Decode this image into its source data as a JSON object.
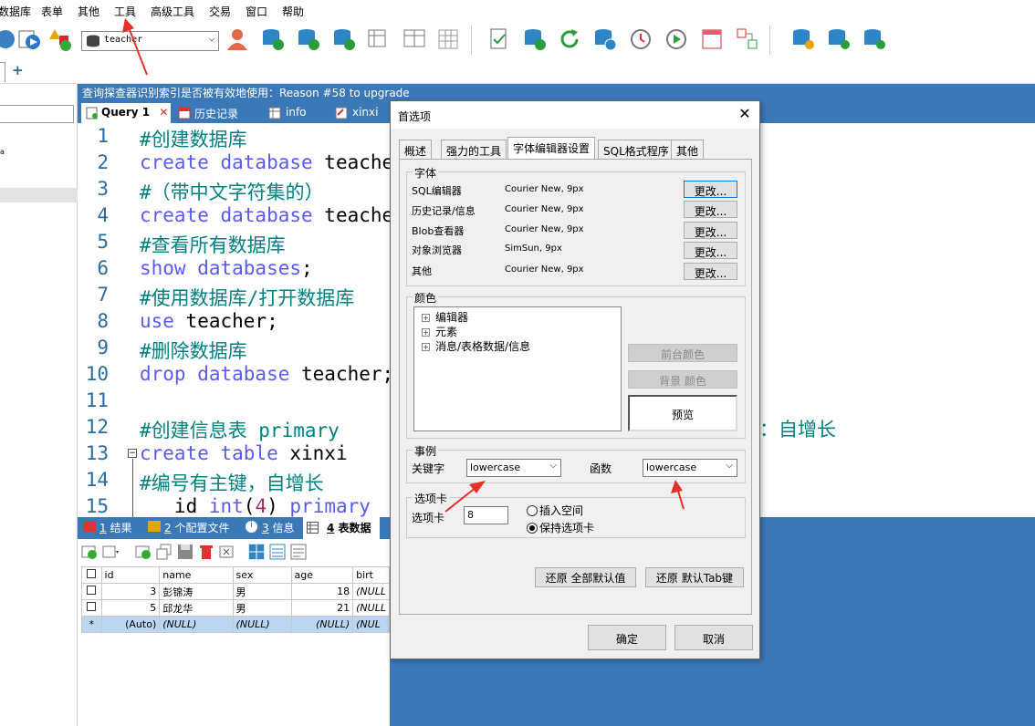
{
  "menu": [
    "数据库",
    "表单",
    "其他",
    "工具",
    "高级工具",
    "交易",
    "窗口",
    "帮助"
  ],
  "toolbar": {
    "db_selected": "teacher"
  },
  "tabstrip": {
    "add_label": "+"
  },
  "infobar": {
    "text": "查询探查器识别索引是否被有效地使用：Reason #58 to upgrade"
  },
  "query_tabs": [
    {
      "label": "Query 1",
      "close": "✕"
    },
    {
      "label": "历史记录"
    },
    {
      "label": "info"
    },
    {
      "label": "xinxi"
    }
  ],
  "editor": {
    "line_numbers": [
      "1",
      "2",
      "3",
      "4",
      "5",
      "6",
      "7",
      "8",
      "9",
      "10",
      "11",
      "12",
      "13",
      "14",
      "15"
    ],
    "lines": [
      [
        {
          "c": "cm",
          "t": "#创建数据库"
        }
      ],
      [
        {
          "c": "kw",
          "t": "create database "
        },
        {
          "c": "tx",
          "t": "teacher;"
        }
      ],
      [
        {
          "c": "cm",
          "t": "#（带中文字符集的）"
        }
      ],
      [
        {
          "c": "kw",
          "t": "create database "
        },
        {
          "c": "tx",
          "t": "teacher"
        }
      ],
      [
        {
          "c": "cm",
          "t": "#查看所有数据库"
        }
      ],
      [
        {
          "c": "kw",
          "t": "show databases"
        },
        {
          "c": "tx",
          "t": ";"
        }
      ],
      [
        {
          "c": "cm",
          "t": "#使用数据库/打开数据库"
        }
      ],
      [
        {
          "c": "kw",
          "t": "use "
        },
        {
          "c": "tx",
          "t": "teacher;"
        }
      ],
      [
        {
          "c": "cm",
          "t": "#删除数据库"
        }
      ],
      [
        {
          "c": "kw",
          "t": "drop database "
        },
        {
          "c": "tx",
          "t": "teacher;"
        }
      ],
      [],
      [
        {
          "c": "cm",
          "t": "#创建信息表 primary"
        }
      ],
      [
        {
          "c": "kw",
          "t": "create table "
        },
        {
          "c": "tx",
          "t": "xinxi"
        }
      ],
      [
        {
          "c": "cm",
          "t": "#编号有主键，自增长"
        }
      ],
      [
        {
          "c": "tx",
          "t": "   id "
        },
        {
          "c": "kw",
          "t": "int"
        },
        {
          "c": "tx",
          "t": "("
        },
        {
          "c": "num",
          "t": "4"
        },
        {
          "c": "tx",
          "t": ") "
        },
        {
          "c": "kw",
          "t": "primary"
        }
      ]
    ],
    "right_fragment": "：自增长"
  },
  "result_tabs": [
    {
      "num": "1",
      "label": "结果"
    },
    {
      "num": "2",
      "label": "个配置文件"
    },
    {
      "num": "3",
      "label": "信息"
    },
    {
      "num": "4",
      "label": "表数据"
    }
  ],
  "grid": {
    "headers": [
      "id",
      "name",
      "sex",
      "age",
      "birt"
    ],
    "rows": [
      {
        "mark": "",
        "id": "3",
        "name": "彭锦涛",
        "sex": "男",
        "age": "18",
        "birth": "(NULL"
      },
      {
        "mark": "",
        "id": "5",
        "name": "邱龙华",
        "sex": "男",
        "age": "21",
        "birth": "(NULL"
      },
      {
        "mark": "*",
        "id": "(Auto)",
        "name": "(NULL)",
        "sex": "(NULL)",
        "age": "(NULL)",
        "birth": "(NUL"
      }
    ]
  },
  "dialog": {
    "title": "首选项",
    "close": "✕",
    "tabs": [
      "概述",
      "强力的工具",
      "字体编辑器设置",
      "SQL格式程序",
      "其他"
    ],
    "font_group": "字体",
    "fonts": [
      {
        "label": "SQL编辑器",
        "value": "Courier New, 9px",
        "btn": "更改..."
      },
      {
        "label": "历史记录/信息",
        "value": "Courier New, 9px",
        "btn": "更改..."
      },
      {
        "label": "Blob查看器",
        "value": "Courier New, 9px",
        "btn": "更改..."
      },
      {
        "label": "对象浏览器",
        "value": "SimSun, 9px",
        "btn": "更改..."
      },
      {
        "label": "其他",
        "value": "Courier New, 9px",
        "btn": "更改..."
      }
    ],
    "color_group": "颜色",
    "color_tree": [
      "编辑器",
      "元素",
      "消息/表格数据/信息"
    ],
    "fg_btn": "前台颜色",
    "bg_btn": "背景 颜色",
    "preview": "预览",
    "case_group": "事例",
    "keyword_label": "关键字",
    "keyword_value": "lowercase",
    "function_label": "函数",
    "function_value": "lowercase",
    "tab_group": "选项卡",
    "tab_label": "选项卡",
    "tab_value": "8",
    "radio_insert": "插入空间",
    "radio_keep": "保持选项卡",
    "restore_defaults": "还原 全部默认值",
    "restore_tab": "还原 默认Tab键",
    "ok": "确定",
    "cancel": "取消"
  },
  "colors": {
    "accent": "#3b78b8",
    "annotation_arrow": "#e8302a"
  }
}
